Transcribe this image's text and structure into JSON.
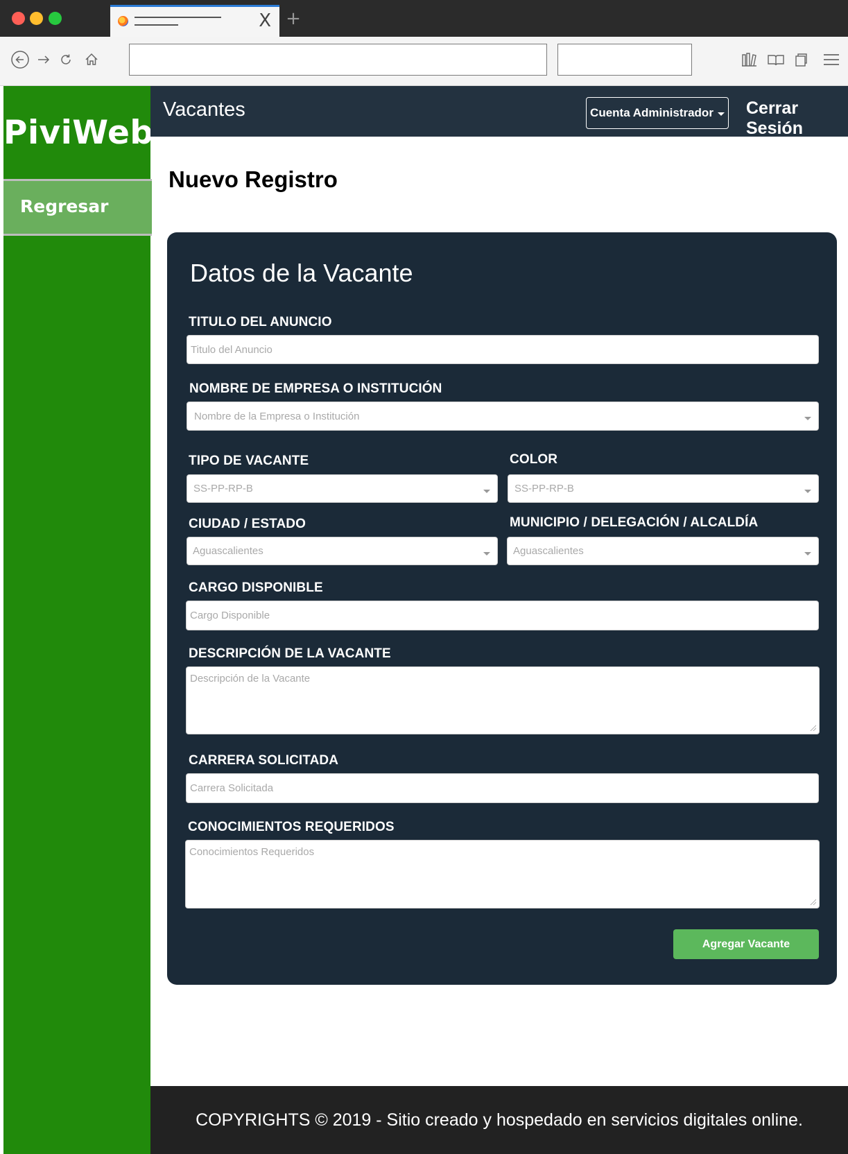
{
  "browser": {
    "tab_close": "X",
    "new_tab": "+",
    "url_value": "",
    "search_value": ""
  },
  "sidebar": {
    "brand": "PiviWeb",
    "items": [
      {
        "label": "Regresar"
      }
    ]
  },
  "header": {
    "section": "Vacantes",
    "account_label": "Cuenta Administrador",
    "logout_label": "Cerrar Sesión"
  },
  "page": {
    "title": "Nuevo Registro"
  },
  "form": {
    "title": "Datos de la Vacante",
    "titulo": {
      "label": "TITULO DEL ANUNCIO",
      "placeholder": "Titulo del Anuncio"
    },
    "empresa": {
      "label": "NOMBRE DE EMPRESA O INSTITUCIÓN",
      "value": "Nombre de la Empresa o Institución"
    },
    "tipo": {
      "label": "TIPO DE VACANTE",
      "value": "SS-PP-RP-B"
    },
    "color": {
      "label": "COLOR",
      "value": "SS-PP-RP-B"
    },
    "ciudad": {
      "label": "CIUDAD / ESTADO",
      "value": "Aguascalientes"
    },
    "municipio": {
      "label": "MUNICIPIO / DELEGACIÓN / ALCALDÍA",
      "value": "Aguascalientes"
    },
    "cargo": {
      "label": "CARGO DISPONIBLE",
      "placeholder": "Cargo Disponible"
    },
    "descripcion": {
      "label": "DESCRIPCIÓN DE LA VACANTE",
      "placeholder": "Descripción de la Vacante"
    },
    "carrera": {
      "label": "CARRERA SOLICITADA",
      "placeholder": "Carrera Solicitada"
    },
    "conocimientos": {
      "label": "CONOCIMIENTOS REQUERIDOS",
      "placeholder": "Conocimientos Requeridos"
    },
    "submit_label": "Agregar Vacante"
  },
  "footer": {
    "text": "COPYRIGHTS © 2019 - Sitio creado y hospedado en servicios digitales online."
  },
  "colors": {
    "sidebar": "#218a0b",
    "sidebar_active": "#6aaf5d",
    "header": "#233240",
    "card": "#1b2a38",
    "submit": "#5cb85c",
    "footer": "#222222"
  }
}
